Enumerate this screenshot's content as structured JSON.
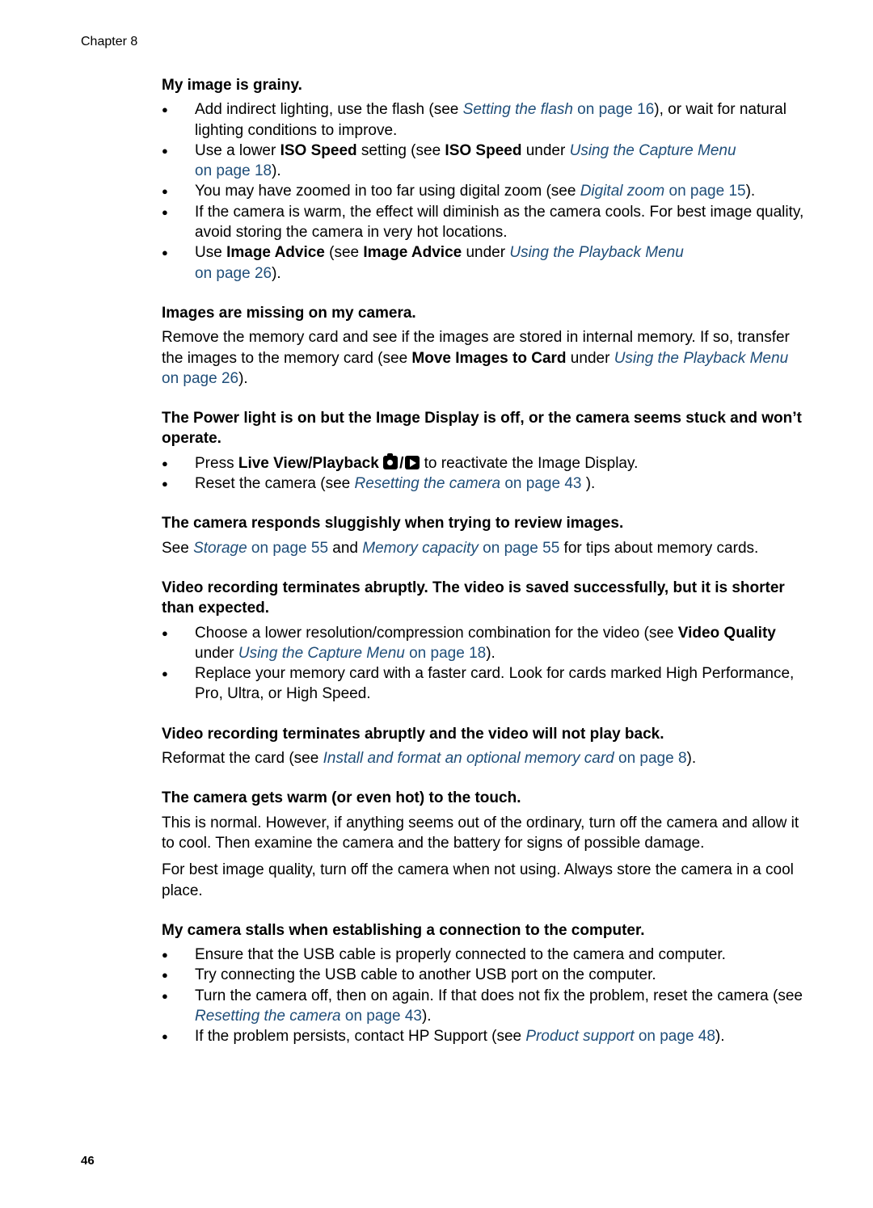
{
  "header": {
    "chapter": "Chapter 8"
  },
  "footer": {
    "page_number": "46"
  },
  "link_color": "#1f4e79",
  "sections": {
    "grainy": {
      "heading": "My image is grainy.",
      "b1": {
        "t1": "Add indirect lighting, use the flash (see ",
        "link": "Setting the flash",
        "page": " on page 16",
        "t2": "), or wait for natural lighting conditions to improve."
      },
      "b2": {
        "t1": "Use a lower ",
        "bold1": "ISO Speed",
        "t2": " setting (see ",
        "bold2": "ISO Speed",
        "t3": " under ",
        "link": "Using the Capture Menu",
        "page": " on page 18",
        "t4": ")."
      },
      "b3": {
        "t1": "You may have zoomed in too far using digital zoom (see ",
        "link": "Digital zoom",
        "page": " on page 15",
        "t2": ")."
      },
      "b4": {
        "t1": "If the camera is warm, the effect will diminish as the camera cools. For best image quality, avoid storing the camera in very hot locations."
      },
      "b5": {
        "t1": "Use ",
        "bold1": "Image Advice",
        "t2": " (see ",
        "bold2": "Image Advice",
        "t3": " under ",
        "link": "Using the Playback Menu",
        "page": " on page 26",
        "t4": ")."
      }
    },
    "missing": {
      "heading": "Images are missing on my camera.",
      "t1": "Remove the memory card and see if the images are stored in internal memory. If so, transfer the images to the memory card (see ",
      "bold1": "Move Images to Card",
      "t2": " under ",
      "link": "Using the Playback Menu",
      "page": " on page 26",
      "t3": ")."
    },
    "power": {
      "heading": "The Power light is on but the Image Display is off, or the camera seems stuck and won’t operate.",
      "b1": {
        "t1": "Press ",
        "bold1": "Live View/Playback",
        "icon1": "camera-icon",
        "slash": "/",
        "icon2": "playback-icon",
        "t2": " to reactivate the Image Display."
      },
      "b2": {
        "t1": "Reset the camera (see ",
        "link": "Resetting the camera",
        "page": " on page 43",
        "t2": " )."
      }
    },
    "sluggish": {
      "heading": "The camera responds sluggishly when trying to review images.",
      "t1": "See ",
      "link1": "Storage",
      "page1": " on page 55",
      "t2": " and ",
      "link2": "Memory capacity",
      "page2": " on page 55",
      "t3": " for tips about memory cards."
    },
    "video_short": {
      "heading": "Video recording terminates abruptly. The video is saved successfully, but it is shorter than expected.",
      "b1": {
        "t1": "Choose a lower resolution/compression combination for the video (see ",
        "bold1": "Video Quality",
        "t2": " under ",
        "link": "Using the Capture Menu",
        "page": " on page 18",
        "t3": ")."
      },
      "b2": {
        "t1": "Replace your memory card with a faster card. Look for cards marked High Performance, Pro, Ultra, or High Speed."
      }
    },
    "video_noplay": {
      "heading": "Video recording terminates abruptly and the video will not play back.",
      "t1": "Reformat the card (see ",
      "link": "Install and format an optional memory card",
      "page": " on page 8",
      "t2": ")."
    },
    "warm": {
      "heading": "The camera gets warm (or even hot) to the touch.",
      "p1": "This is normal. However, if anything seems out of the ordinary, turn off the camera and allow it to cool. Then examine the camera and the battery for signs of possible damage.",
      "p2": "For best image quality, turn off the camera when not using. Always store the camera in a cool place."
    },
    "stalls": {
      "heading": "My camera stalls when establishing a connection to the computer.",
      "b1": {
        "t1": "Ensure that the USB cable is properly connected to the camera and computer."
      },
      "b2": {
        "t1": "Try connecting the USB cable to another USB port on the computer."
      },
      "b3": {
        "t1": "Turn the camera off, then on again. If that does not fix the problem, reset the camera (see ",
        "link": "Resetting the camera",
        "page": " on page 43",
        "t2": ")."
      },
      "b4": {
        "t1": "If the problem persists, contact HP Support (see ",
        "link": "Product support",
        "page": " on page 48",
        "t2": ")."
      }
    }
  }
}
